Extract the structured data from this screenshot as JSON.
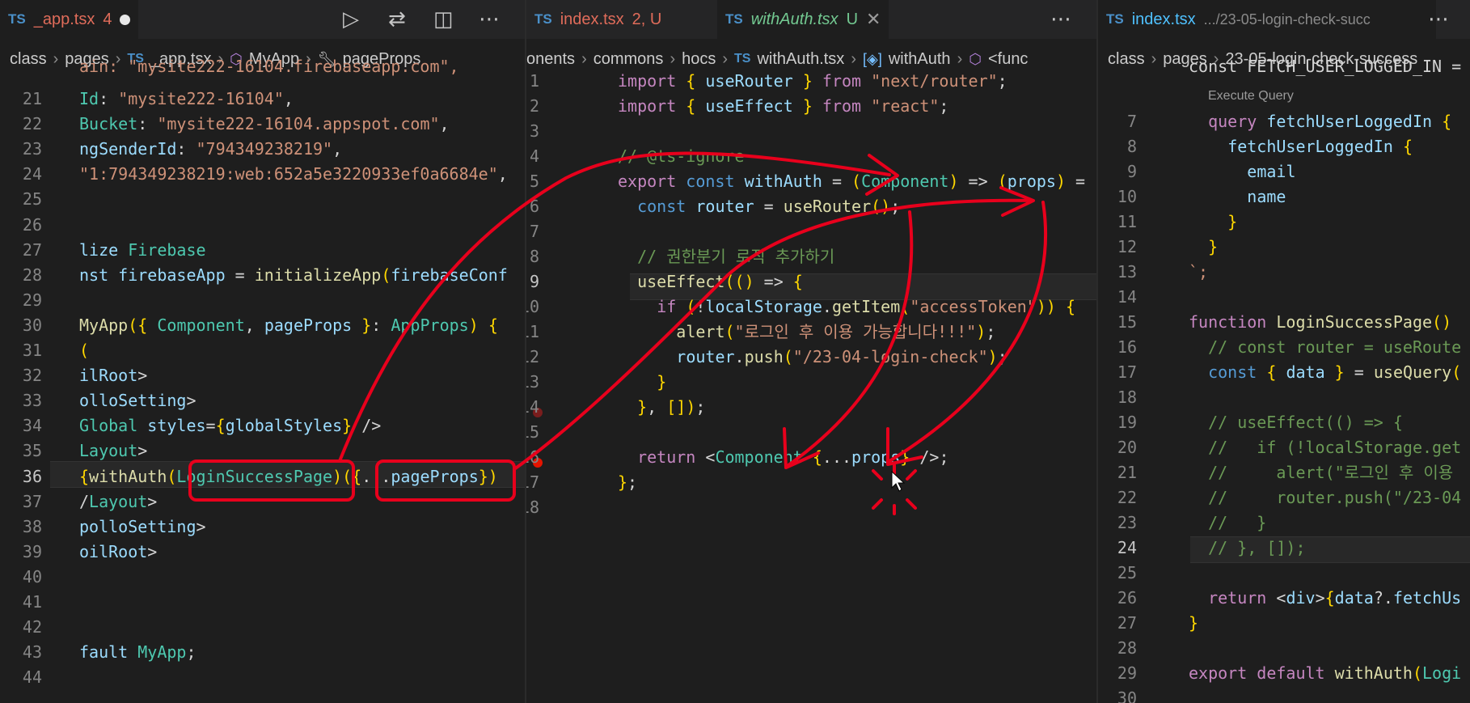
{
  "left": {
    "tab": {
      "lang": "TS",
      "name": "_app.tsx",
      "badge": "4"
    },
    "breadcrumbs": [
      "class",
      "pages",
      "_app.tsx",
      "MyApp",
      "pageProps"
    ],
    "lines": [
      {
        "n": "21",
        "t": "Id: \"mysite222-16104\","
      },
      {
        "n": "22",
        "t": "Bucket: \"mysite222-16104.appspot.com\","
      },
      {
        "n": "23",
        "t": "ngSenderId: \"794349238219\","
      },
      {
        "n": "24",
        "t": "\"1:794349238219:web:652a5e3220933ef0a6684e\","
      },
      {
        "n": "25",
        "t": ""
      },
      {
        "n": "26",
        "t": ""
      },
      {
        "n": "27",
        "t": "lize Firebase"
      },
      {
        "n": "28",
        "t": "nst firebaseApp = initializeApp(firebaseConf"
      },
      {
        "n": "29",
        "t": ""
      },
      {
        "n": "30",
        "t": "MyApp({ Component, pageProps }: AppProps) {"
      },
      {
        "n": "31",
        "t": "("
      },
      {
        "n": "32",
        "t": "ilRoot>"
      },
      {
        "n": "33",
        "t": "olloSetting>"
      },
      {
        "n": "34",
        "t": "Global styles={globalStyles} />"
      },
      {
        "n": "35",
        "t": "Layout>"
      },
      {
        "n": "36",
        "t": "{withAuth(LoginSuccessPage)({...pageProps})"
      },
      {
        "n": "37",
        "t": "/Layout>"
      },
      {
        "n": "38",
        "t": "polloSetting>"
      },
      {
        "n": "39",
        "t": "oilRoot>"
      },
      {
        "n": "40",
        "t": ""
      },
      {
        "n": "41",
        "t": ""
      },
      {
        "n": "42",
        "t": ""
      },
      {
        "n": "43",
        "t": "fault MyApp;"
      },
      {
        "n": "44",
        "t": ""
      }
    ]
  },
  "middle": {
    "tabs": [
      {
        "lang": "TS",
        "name": "index.tsx",
        "badge": "2, U"
      },
      {
        "lang": "TS",
        "name": "withAuth.tsx",
        "badge": "U"
      }
    ],
    "breadcrumbs": [
      "onents",
      "commons",
      "hocs",
      "withAuth.tsx",
      "withAuth",
      "<func"
    ],
    "lines": [
      {
        "n": "1",
        "t": "import { useRouter } from \"next/router\";"
      },
      {
        "n": "2",
        "t": "import { useEffect } from \"react\";"
      },
      {
        "n": "3",
        "t": ""
      },
      {
        "n": "4",
        "t": "// @ts-ignore"
      },
      {
        "n": "5",
        "t": "export const withAuth = (Component) => (props) ="
      },
      {
        "n": "6",
        "t": "  const router = useRouter();"
      },
      {
        "n": "7",
        "t": ""
      },
      {
        "n": "8",
        "t": "  // 권한분기 로직 추가하기"
      },
      {
        "n": "9",
        "t": "  useEffect(() => {"
      },
      {
        "n": "10",
        "t": "    if (!localStorage.getItem(\"accessToken\")) {"
      },
      {
        "n": "11",
        "t": "      alert(\"로그인 후 이용 가능합니다!!!\");"
      },
      {
        "n": "12",
        "t": "      router.push(\"/23-04-login-check\");"
      },
      {
        "n": "13",
        "t": "    }"
      },
      {
        "n": "14",
        "t": "  }, []);"
      },
      {
        "n": "15",
        "t": ""
      },
      {
        "n": "16",
        "t": "  return <Component {...props} />;"
      },
      {
        "n": "17",
        "t": "};"
      },
      {
        "n": "18",
        "t": ""
      }
    ]
  },
  "right": {
    "tab": {
      "lang": "TS",
      "name": "index.tsx",
      "path": ".../23-05-login-check-succ"
    },
    "breadcrumbs": [
      "class",
      "pages",
      "23-05-login-check-success"
    ],
    "execute_query": "Execute Query",
    "top_partial": "const FETCH_USER_LOGGED_IN =",
    "lines": [
      {
        "n": "7",
        "t": "  query fetchUserLoggedIn {"
      },
      {
        "n": "8",
        "t": "    fetchUserLoggedIn {"
      },
      {
        "n": "9",
        "t": "      email"
      },
      {
        "n": "10",
        "t": "      name"
      },
      {
        "n": "11",
        "t": "    }"
      },
      {
        "n": "12",
        "t": "  }"
      },
      {
        "n": "13",
        "t": "`;"
      },
      {
        "n": "14",
        "t": ""
      },
      {
        "n": "15",
        "t": "function LoginSuccessPage()"
      },
      {
        "n": "16",
        "t": "  // const router = useRoute"
      },
      {
        "n": "17",
        "t": "  const { data } = useQuery("
      },
      {
        "n": "18",
        "t": ""
      },
      {
        "n": "19",
        "t": "  // useEffect(() => {"
      },
      {
        "n": "20",
        "t": "  //   if (!localStorage.get"
      },
      {
        "n": "21",
        "t": "  //     alert(\"로그인 후 이용"
      },
      {
        "n": "22",
        "t": "  //     router.push(\"/23-04"
      },
      {
        "n": "23",
        "t": "  //   }"
      },
      {
        "n": "24",
        "t": "  // }, []);"
      },
      {
        "n": "25",
        "t": ""
      },
      {
        "n": "26",
        "t": "  return <div>{data?.fetchUs"
      },
      {
        "n": "27",
        "t": "}"
      },
      {
        "n": "28",
        "t": ""
      },
      {
        "n": "29",
        "t": "export default withAuth(Logi"
      },
      {
        "n": "30",
        "t": ""
      }
    ]
  },
  "colors": {
    "annotation": "#e8001c",
    "modified": "#e06c5a",
    "untracked": "#73c991"
  }
}
